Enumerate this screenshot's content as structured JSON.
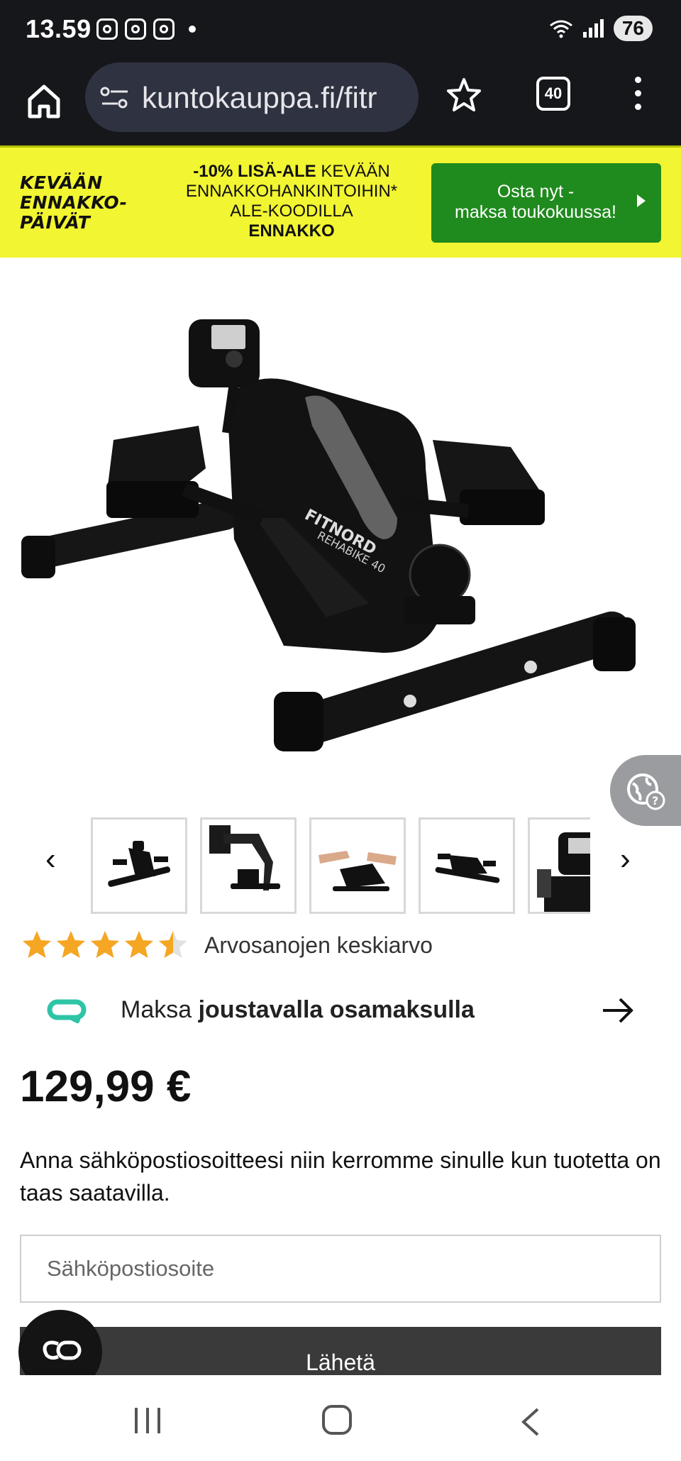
{
  "status_bar": {
    "time": "13.59",
    "battery": "76",
    "icons": [
      "screenshot-icon",
      "instagram-icon",
      "instagram-icon",
      "notification-dot",
      "wifi-icon",
      "signal-icon",
      "battery-icon"
    ]
  },
  "browser": {
    "url": "kuntokauppa.fi/fitr",
    "tab_count": "40",
    "icons": [
      "home-icon",
      "site-settings-icon",
      "bookmark-star-icon",
      "tabs-icon",
      "more-menu-icon"
    ]
  },
  "promo": {
    "logo_line1": "KEVÄÄN",
    "logo_line2": "ENNAKKO-",
    "logo_line3": "PÄIVÄT",
    "text_bold": "-10% LISÄ-ALE",
    "text_line1_rest": " KEVÄÄN",
    "text_line2": "ENNAKKOHANKINTOIHIN*",
    "text_line3": "ALE-KOODILLA",
    "text_code": "ENNAKKO",
    "button_line1": "Osta nyt -",
    "button_line2": "maksa toukokuussa!",
    "colors": {
      "background": "#f2f531",
      "button": "#1f8a1d"
    }
  },
  "product": {
    "image_alt": "FITNORD REHABIKE 40",
    "brand_print": "FITNORD",
    "model_print": "REHABIKE 40",
    "thumbnails": [
      "thumb-bike-side",
      "thumb-bike-legs",
      "thumb-bike-hands",
      "thumb-bike-floor",
      "thumb-bike-display"
    ],
    "prev_arrow": "‹",
    "next_arrow": "›",
    "rating_stars": 4.5,
    "rating_max": 5,
    "rating_label": "Arvosanojen keskiarvo",
    "installment_prefix": "Maksa ",
    "installment_bold": "joustavalla osamaksulla",
    "price": "129,99 €",
    "notify_text": "Anna sähköpostiosoitteesi niin kerromme sinulle kun tuotetta on taas saatavilla.",
    "email_placeholder": "Sähköpostiosoite",
    "submit_label": "Lähetä",
    "star_color": "#f5a623",
    "installment_logo_color": "#2ec4a6"
  }
}
